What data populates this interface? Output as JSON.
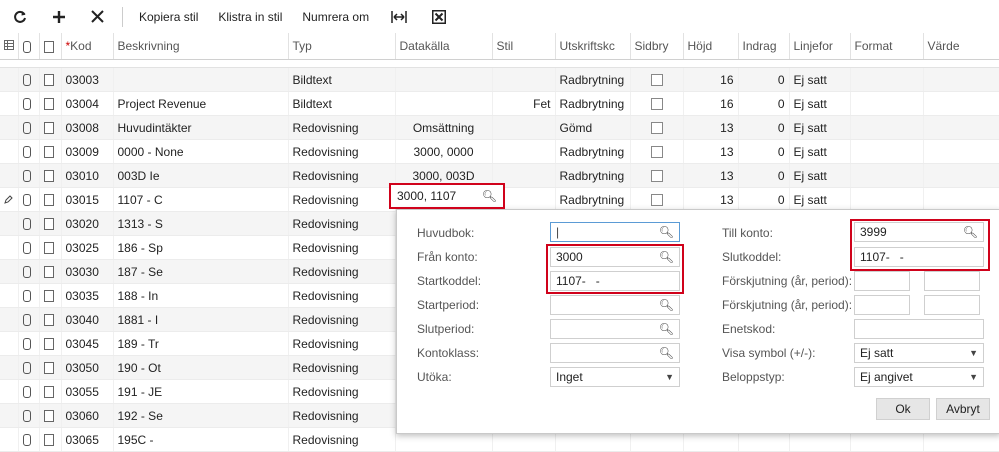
{
  "toolbar": {
    "copy_style": "Kopiera stil",
    "paste_style": "Klistra in stil",
    "number_as": "Numrera om"
  },
  "columns": {
    "kod": "Kod",
    "beskrivning": "Beskrivning",
    "typ": "Typ",
    "datakalla": "Datakälla",
    "stil": "Stil",
    "utskriftskod": "Utskriftskc",
    "sidbryt": "Sidbry",
    "hojd": "Höjd",
    "indrag": "Indrag",
    "linjeform": "Linjefor",
    "format": "Format",
    "varde": "Värde"
  },
  "rows": [
    {
      "kod": "03003",
      "beskrivning": "",
      "typ": "Bildtext",
      "datakalla": "",
      "stil": "",
      "utskrift": "Radbrytning",
      "hojd": "16",
      "indrag": "0",
      "linje": "Ej satt"
    },
    {
      "kod": "03004",
      "beskrivning": "Project Revenue",
      "typ": "Bildtext",
      "datakalla": "",
      "stil": "Fet",
      "utskrift": "Radbrytning",
      "hojd": "16",
      "indrag": "0",
      "linje": "Ej satt"
    },
    {
      "kod": "03008",
      "beskrivning": "Huvudintäkter",
      "typ": "Redovisning",
      "datakalla": "Omsättning",
      "stil": "",
      "utskrift": "Gömd",
      "hojd": "13",
      "indrag": "0",
      "linje": "Ej satt"
    },
    {
      "kod": "03009",
      "beskrivning": "0000 - None",
      "typ": "Redovisning",
      "datakalla": "3000, 0000",
      "stil": "",
      "utskrift": "Radbrytning",
      "hojd": "13",
      "indrag": "0",
      "linje": "Ej satt"
    },
    {
      "kod": "03010",
      "beskrivning": "003D  Ie",
      "typ": "Redovisning",
      "datakalla": "3000, 003D",
      "stil": "",
      "utskrift": "Radbrytning",
      "hojd": "13",
      "indrag": "0",
      "linje": "Ej satt"
    },
    {
      "kod": "03015",
      "beskrivning": "1107 - C",
      "typ": "Redovisning",
      "datakalla": "",
      "stil": "",
      "utskrift": "Radbrytning",
      "hojd": "13",
      "indrag": "0",
      "linje": "Ej satt"
    },
    {
      "kod": "03020",
      "beskrivning": "1313 - S",
      "typ": "Redovisning"
    },
    {
      "kod": "03025",
      "beskrivning": "186 - Sp",
      "typ": "Redovisning"
    },
    {
      "kod": "03030",
      "beskrivning": "187 - Se",
      "typ": "Redovisning"
    },
    {
      "kod": "03035",
      "beskrivning": "188 - In",
      "typ": "Redovisning"
    },
    {
      "kod": "03040",
      "beskrivning": "1881 - I",
      "typ": "Redovisning"
    },
    {
      "kod": "03045",
      "beskrivning": "189 - Tr",
      "typ": "Redovisning"
    },
    {
      "kod": "03050",
      "beskrivning": "190 - Ot",
      "typ": "Redovisning"
    },
    {
      "kod": "03055",
      "beskrivning": "191 - JE",
      "typ": "Redovisning"
    },
    {
      "kod": "03060",
      "beskrivning": "192 - Se",
      "typ": "Redovisning"
    },
    {
      "kod": "03065",
      "beskrivning": "195C - ",
      "typ": "Redovisning"
    }
  ],
  "cell_editor": {
    "value": "3000, 1107"
  },
  "popup": {
    "huvudbok_label": "Huvudbok:",
    "fran_konto_label": "Från konto:",
    "fran_konto_value": "3000",
    "startkoddel_label": "Startkoddel:",
    "startkoddel_value": "1107-   -",
    "startperiod_label": "Startperiod:",
    "slutperiod_label": "Slutperiod:",
    "kontoklass_label": "Kontoklass:",
    "utoka_label": "Utöka:",
    "utoka_value": "Inget",
    "till_konto_label": "Till konto:",
    "till_konto_value": "3999",
    "slutkoddel_label": "Slutkoddel:",
    "slutkoddel_value": "1107-   -",
    "forskjutning1_label": "Förskjutning (år, period):",
    "forskjutning2_label": "Förskjutning (år, period):",
    "enetskod_label": "Enetskod:",
    "visa_symbol_label": "Visa symbol (+/-):",
    "visa_symbol_value": "Ej satt",
    "beloppstyp_label": "Beloppstyp:",
    "beloppstyp_value": "Ej angivet",
    "ok_label": "Ok",
    "avbryt_label": "Avbryt"
  }
}
